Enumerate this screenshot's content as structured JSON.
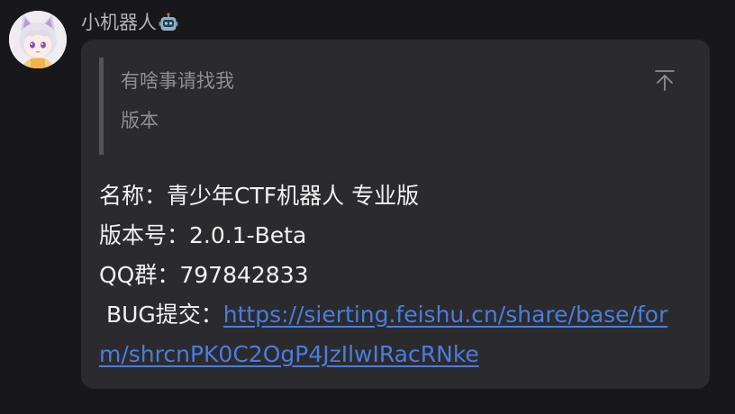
{
  "sender": {
    "name": "小机器人",
    "badge_icon": "robot-icon"
  },
  "quote": {
    "line1": "有啥事请找我",
    "line2": "版本",
    "collapse_icon": "collapse-to-top-icon"
  },
  "info": {
    "name_label": "名称：",
    "name_value": "青少年CTF机器人 专业版",
    "version_label": "版本号：",
    "version_value": "2.0.1-Beta",
    "qq_label": "QQ群：",
    "qq_value": "797842833",
    "bug_label": " BUG提交：",
    "bug_link_part1": "https://sierting.feishu.cn/share/base/for",
    "bug_link_part2": "m/shrcnPK0C2OgP4JzIlwIRacRNke"
  },
  "colors": {
    "background": "#18181a",
    "bubble": "#2b2b2e",
    "link": "#4a7cde",
    "quote_bar": "#545458"
  }
}
